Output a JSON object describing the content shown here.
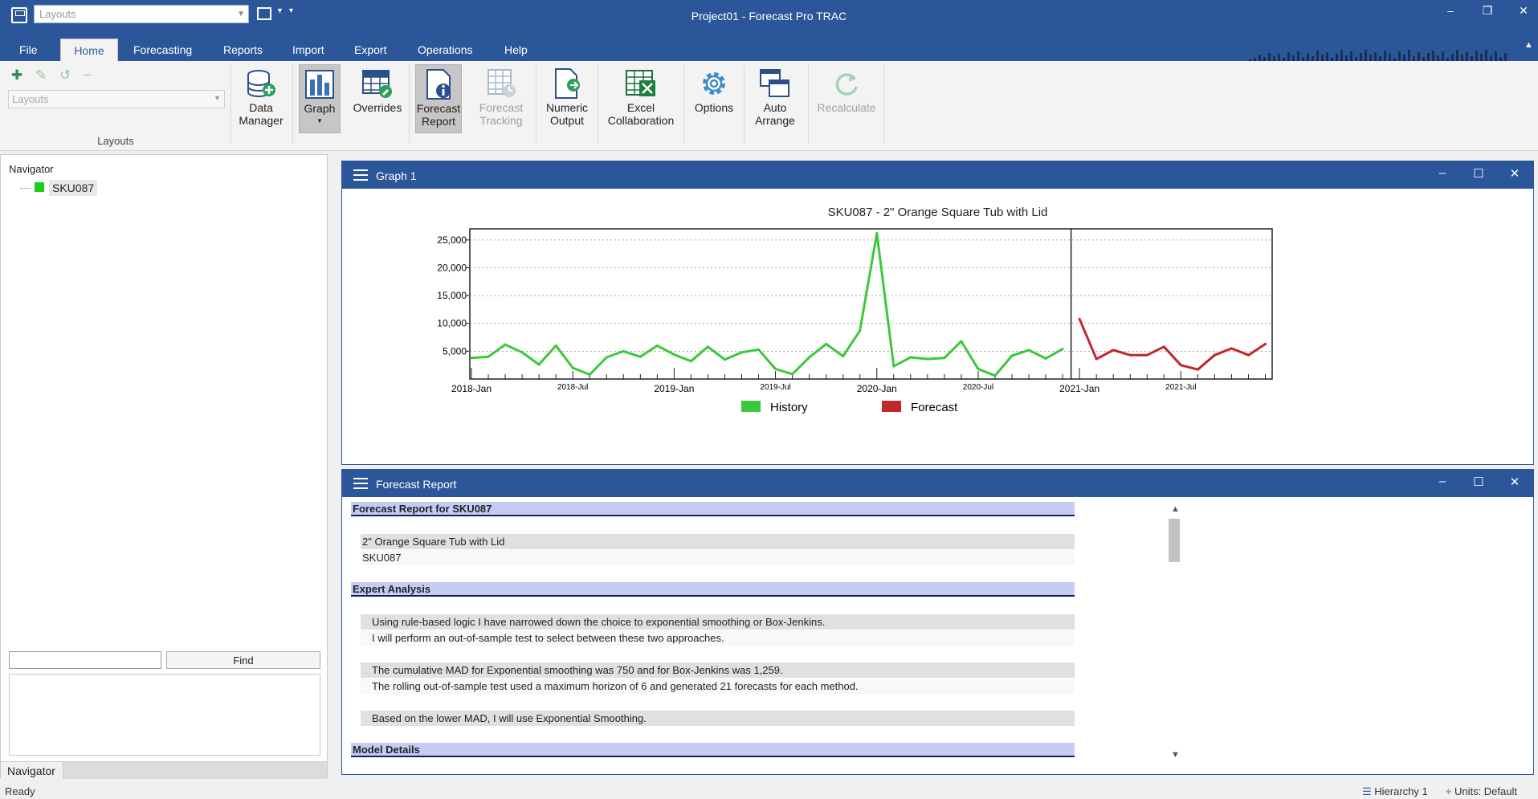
{
  "app": {
    "title": "Project01 - Forecast Pro TRAC",
    "quick_access_layout_placeholder": "Layouts"
  },
  "tabs": [
    {
      "label": "File",
      "active": false
    },
    {
      "label": "Home",
      "active": true
    },
    {
      "label": "Forecasting",
      "active": false
    },
    {
      "label": "Reports",
      "active": false
    },
    {
      "label": "Import",
      "active": false
    },
    {
      "label": "Export",
      "active": false
    },
    {
      "label": "Operations",
      "active": false
    },
    {
      "label": "Help",
      "active": false
    }
  ],
  "ribbon": {
    "layouts_group_label": "Layouts",
    "layouts_combo_placeholder": "Layouts",
    "buttons": {
      "data_manager": [
        "Data",
        "Manager"
      ],
      "graph": [
        "Graph"
      ],
      "overrides": [
        "Overrides"
      ],
      "forecast_report": [
        "Forecast",
        "Report"
      ],
      "forecast_tracking": [
        "Forecast",
        "Tracking"
      ],
      "numeric_output": [
        "Numeric",
        "Output"
      ],
      "excel_collaboration": [
        "Excel",
        "Collaboration"
      ],
      "options": [
        "Options"
      ],
      "auto_arrange": [
        "Auto",
        "Arrange"
      ],
      "recalculate": [
        "Recalculate"
      ]
    }
  },
  "navigator": {
    "title": "Navigator",
    "items": [
      {
        "label": "SKU087",
        "color": "#18d018"
      }
    ],
    "find_label": "Find",
    "tab_label": "Navigator"
  },
  "graph_panel": {
    "title": "Graph 1"
  },
  "chart_data": {
    "type": "line",
    "title": "SKU087 - 2\" Orange Square Tub with Lid",
    "y_ticks": [
      "25,000",
      "20,000",
      "15,000",
      "10,000",
      "5,000"
    ],
    "y_tick_values": [
      25000,
      20000,
      15000,
      10000,
      5000
    ],
    "ylim": [
      0,
      27000
    ],
    "x_labels_major": [
      "2018-Jan",
      "2019-Jan",
      "2020-Jan",
      "2021-Jan"
    ],
    "x_labels_minor": [
      "2018-Jul",
      "2019-Jul",
      "2020-Jul",
      "2021-Jul"
    ],
    "series": [
      {
        "name": "History",
        "color": "#3cc83c",
        "start": "2018-Jan",
        "values": [
          3800,
          4000,
          6200,
          4800,
          2600,
          6000,
          2000,
          800,
          3900,
          5000,
          4000,
          6000,
          4400,
          3200,
          5800,
          3500,
          4800,
          5300,
          1800,
          900,
          3900,
          6300,
          4100,
          8700,
          26200,
          2300,
          3900,
          3600,
          3800,
          6800,
          1800,
          600,
          4200,
          5200,
          3700,
          5400
        ]
      },
      {
        "name": "Forecast",
        "color": "#c0282d",
        "start": "2021-Jan",
        "values": [
          10800,
          3600,
          5200,
          4300,
          4300,
          5800,
          2500,
          1700,
          4300,
          5500,
          4300,
          6300
        ]
      }
    ],
    "legend": [
      "History",
      "Forecast"
    ],
    "legend_position": "bottom"
  },
  "report_panel": {
    "title": "Forecast Report",
    "sections": {
      "header": "Forecast Report for SKU087",
      "expert": "Expert Analysis",
      "model": "Model Details"
    },
    "item_description": "2\" Orange Square Tub with Lid",
    "item_code": "SKU087",
    "lines": [
      "Using rule-based logic I have narrowed down the choice to exponential smoothing or Box-Jenkins.",
      "I will perform an out-of-sample test to select between these two approaches.",
      "The cumulative MAD for Exponential smoothing was 750 and for Box-Jenkins was 1,259.",
      "The rolling out-of-sample test used a maximum horizon of 6 and generated 21 forecasts for each method.",
      "Based on the lower MAD, I will use Exponential Smoothing."
    ]
  },
  "status": {
    "left": "Ready",
    "hierarchy": "Hierarchy 1",
    "units": "Units: Default"
  }
}
